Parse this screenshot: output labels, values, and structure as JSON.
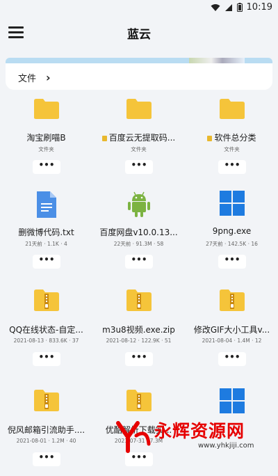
{
  "status_bar": {
    "time": "10:19"
  },
  "header": {
    "title": "蓝云",
    "menu_icon": "hamburger-menu-icon"
  },
  "breadcrumb": {
    "label": "文件",
    "chevron": "›"
  },
  "items": [
    {
      "name": "淘宝刷喵B",
      "meta": "文件夹",
      "type": "folder",
      "locked": false
    },
    {
      "name": "百度云无提取码...",
      "meta": "文件夹",
      "type": "folder",
      "locked": true
    },
    {
      "name": "软件总分类",
      "meta": "文件夹",
      "type": "folder",
      "locked": true
    },
    {
      "name": "删微博代码.txt",
      "meta": "21天前 · 1.1K · 4",
      "type": "doc",
      "locked": false
    },
    {
      "name": "百度网盘v10.0.13...",
      "meta": "22天前 · 91.3M · 58",
      "type": "android",
      "locked": false
    },
    {
      "name": "9png.exe",
      "meta": "27天前 · 142.5K · 16",
      "type": "windows",
      "locked": false
    },
    {
      "name": "QQ在线状态-自定...",
      "meta": "2021-08-13 · 833.6K · 37",
      "type": "zip",
      "locked": false
    },
    {
      "name": "m3u8视频.exe.zip",
      "meta": "2021-08-12 · 122.9K · 51",
      "type": "zip",
      "locked": false
    },
    {
      "name": "修改GIF大小工具v...",
      "meta": "2021-08-04 · 1.4M · 12",
      "type": "zip",
      "locked": false
    },
    {
      "name": "倪风邮箱引流助手....",
      "meta": "2021-08-01 · 1.2M · 40",
      "type": "zip",
      "locked": false
    },
    {
      "name": "优酷解析下载实...",
      "meta": "2021-07-31 · 7.3M",
      "type": "zip",
      "locked": false
    },
    {
      "name": "",
      "meta": "",
      "type": "windows",
      "locked": false
    }
  ],
  "more_label": "•••",
  "watermark": {
    "text": "永辉资源网",
    "url": "www.yhkjiji.com"
  },
  "colors": {
    "folder": "#f5c43a",
    "zip": "#f5c43a",
    "doc": "#4b8fe6",
    "android": "#7cb342",
    "windows": "#1e7be0"
  }
}
